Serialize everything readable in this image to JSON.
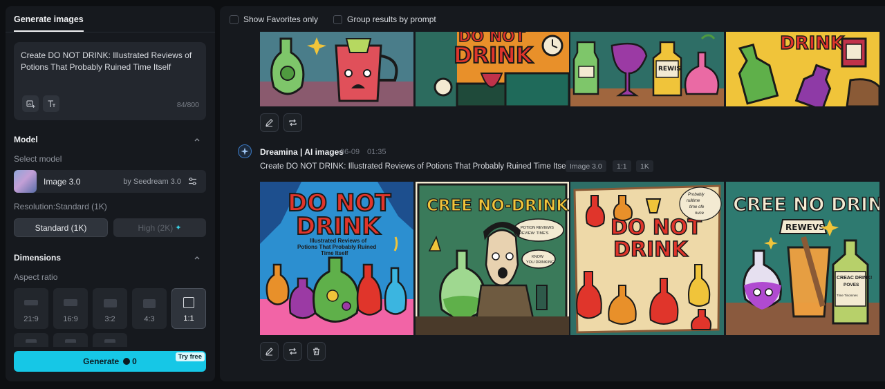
{
  "sidebar": {
    "tab_label": "Generate images",
    "prompt": {
      "text": "Create DO NOT DRINK: Illustrated Reviews of Potions That Probably Ruined Time Itself",
      "char_count": "84/800"
    },
    "model_section": {
      "title": "Model",
      "select_label": "Select model",
      "model_name": "Image 3.0",
      "model_provider": "by Seedream 3.0"
    },
    "resolution": {
      "label": "Resolution:Standard (1K)",
      "standard_label": "Standard (1K)",
      "high_label": "High (2K)"
    },
    "dimensions": {
      "title": "Dimensions",
      "aspect_label": "Aspect ratio",
      "ratios": [
        "21:9",
        "16:9",
        "3:2",
        "4:3",
        "1:1"
      ],
      "selected": "1:1"
    },
    "generate": {
      "label": "Generate",
      "credits": "0",
      "badge": "Try free"
    }
  },
  "results": {
    "filters": {
      "favorites_label": "Show Favorites only",
      "group_label": "Group results by prompt"
    },
    "top_row": {
      "texts": [
        "DO NOT",
        "DRINK",
        "REWIS",
        "DRINK."
      ]
    },
    "entry": {
      "author": "Dreamina | AI images",
      "date": "06-09",
      "time": "01:35",
      "prompt": "Create DO NOT DRINK: Illustrated Reviews of Potions That Probably Ruined Time Itself",
      "tags": [
        "Image 3.0",
        "1:1",
        "1K"
      ],
      "images": [
        {
          "line1": "DO NOT",
          "line2": "DRINK",
          "caption1": "Illustrated Reviews of",
          "caption2": "Potions That Probably Ruined",
          "caption3": "Time Itself"
        },
        {
          "headline": "CREE NO-DRINK!",
          "bubble1": "POTION REVIEWS",
          "bubble2": "REVIEW: TIME'S",
          "bubble3": "KNOW",
          "bubble4": "YOU DRINKING"
        },
        {
          "line1": "DO NOT",
          "line2": "DRINK",
          "note1": "Probably",
          "note2": "ruiltime",
          "note3": "time ofe",
          "note4": "nuce"
        },
        {
          "headline": "CREE NO DRINK!",
          "sign": "REWEVS",
          "label1": "CREAC DRINK!",
          "label2": "POVES",
          "label3": "Time Tinomnes"
        }
      ]
    }
  },
  "colors": {
    "accent": "#16c7e6",
    "panel": "#16191e",
    "background": "#0d0f12"
  }
}
